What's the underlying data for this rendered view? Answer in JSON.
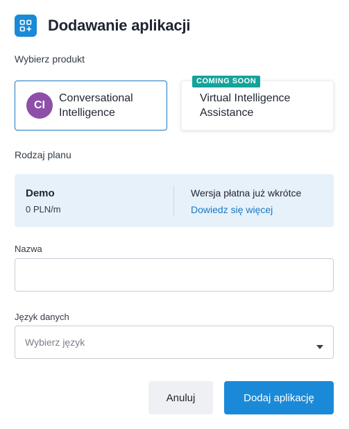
{
  "header": {
    "title": "Dodawanie aplikacji",
    "icon": "apps-add-icon",
    "accent_color": "#1a8ad8"
  },
  "product_section": {
    "label": "Wybierz produkt",
    "cards": [
      {
        "avatar": "CI",
        "label": "Conversational Intelligence",
        "selected": true,
        "avatar_color": "#8e4fa8"
      },
      {
        "badge": "COMING SOON",
        "label": "Virtual Intelligence Assistance",
        "selected": false,
        "badge_color": "#14a39a"
      }
    ]
  },
  "plan_section": {
    "label": "Rodzaj planu",
    "plan_name": "Demo",
    "plan_price": "0 PLN/m",
    "paid_note": "Wersja płatna już wkrótce",
    "learn_more": "Dowiedz się więcej"
  },
  "form": {
    "name_label": "Nazwa",
    "name_value": "",
    "language_label": "Język danych",
    "language_placeholder": "Wybierz język"
  },
  "actions": {
    "cancel": "Anuluj",
    "submit": "Dodaj aplikację"
  }
}
